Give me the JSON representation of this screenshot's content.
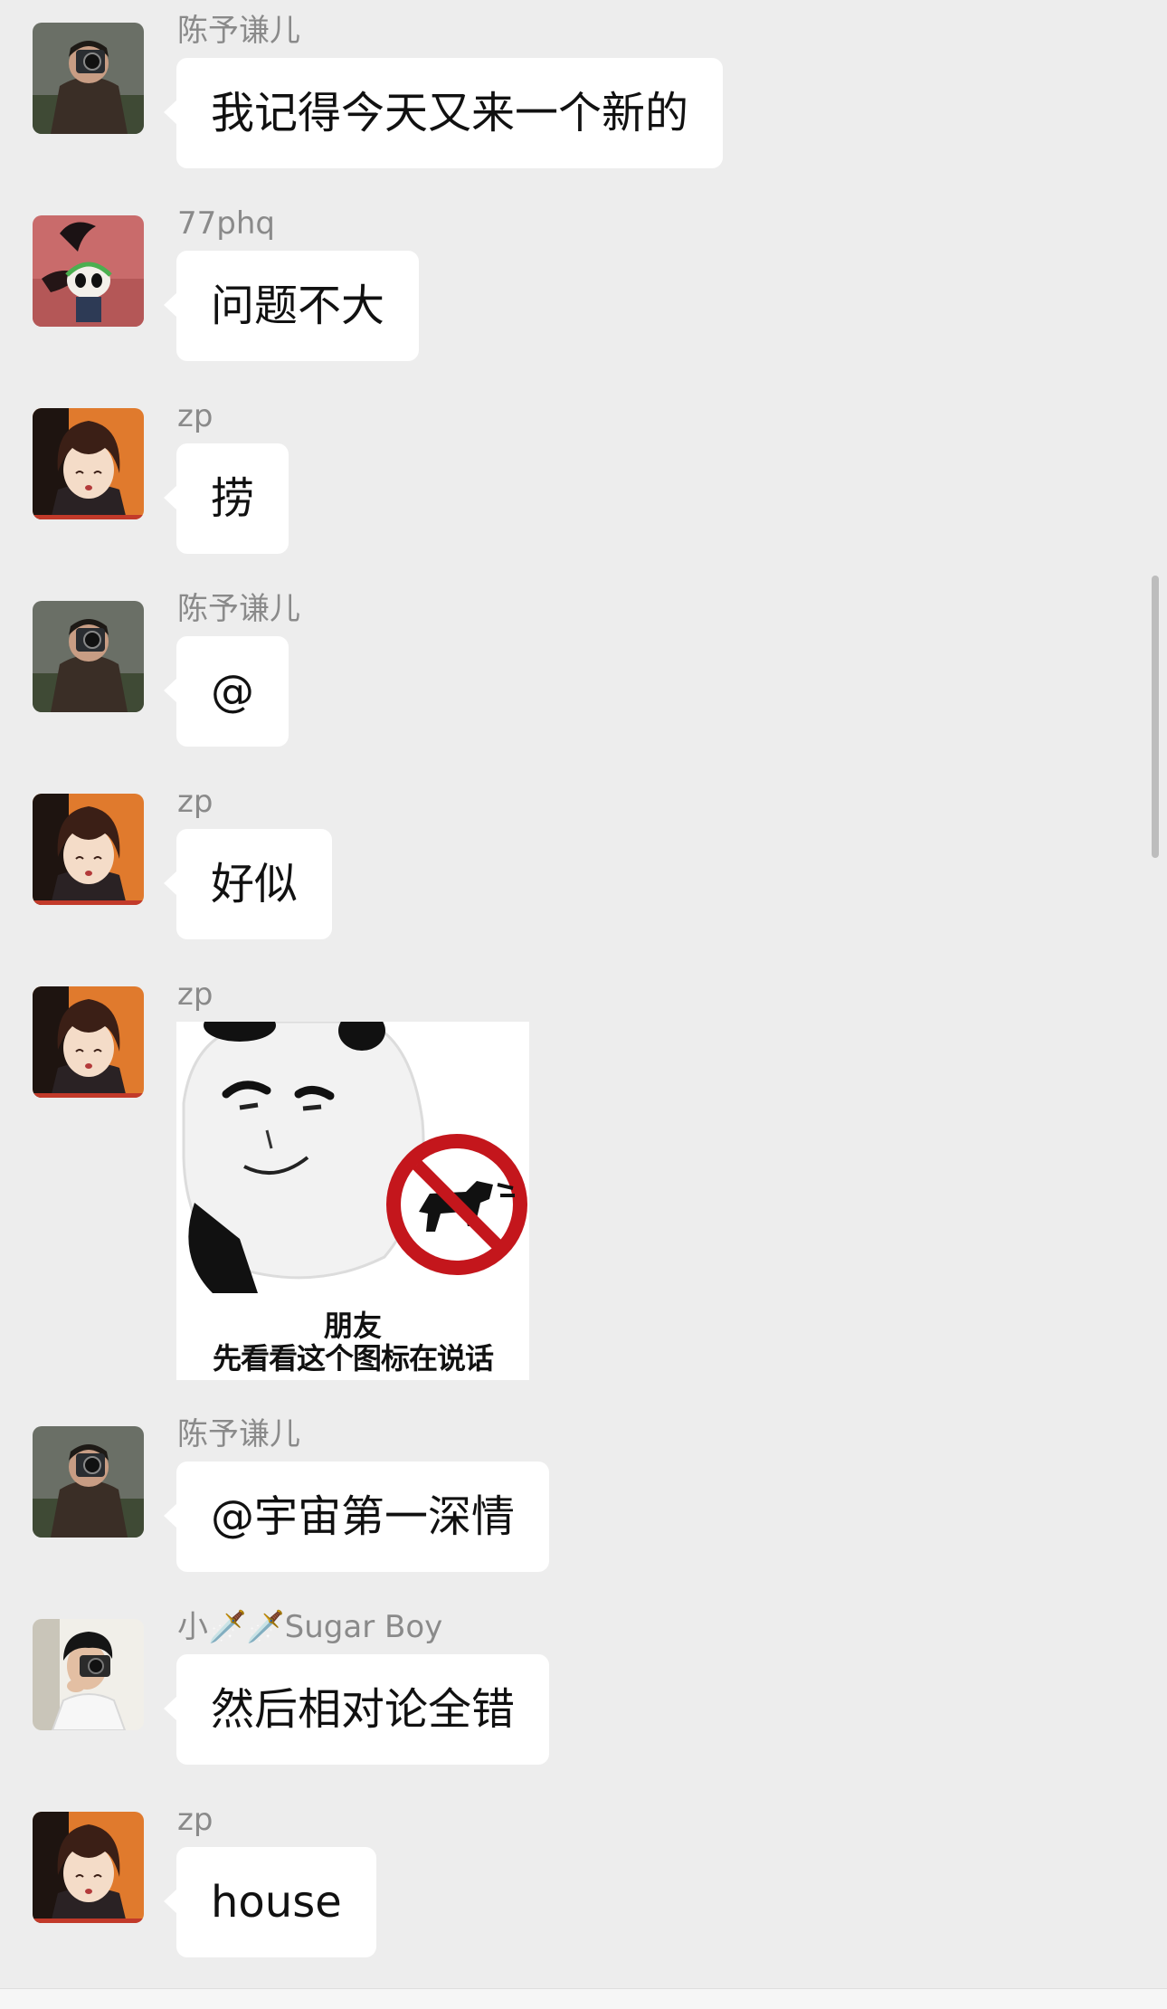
{
  "messages": [
    {
      "sender": "陈予谦儿",
      "text": "我记得今天又来一个新的",
      "avatar": "photo-with-camera"
    },
    {
      "sender": "77phq",
      "text": "问题不大",
      "avatar": "hollow-knight-art"
    },
    {
      "sender": "zp",
      "text": "捞",
      "avatar": "anime-boy-dazai"
    },
    {
      "sender": "陈予谦儿",
      "text": "@",
      "avatar": "photo-with-camera"
    },
    {
      "sender": "zp",
      "text": "好似",
      "avatar": "anime-boy-dazai"
    },
    {
      "sender": "zp",
      "sticker": {
        "line1": "朋友",
        "line2": "先看看这个图标在说话"
      },
      "avatar": "anime-boy-dazai"
    },
    {
      "sender": "陈予谦儿",
      "text": "@宇宙第一深情",
      "avatar": "photo-with-camera"
    },
    {
      "sender": "小🗡️🗡️Sugar Boy",
      "text": "然后相对论全错",
      "avatar": "boy-with-camera-photo"
    },
    {
      "sender": "zp",
      "text": "house",
      "avatar": "anime-boy-dazai"
    }
  ],
  "colors": {
    "background": "#ededed",
    "bubble": "#ffffff",
    "sender_text": "#8a8a8a",
    "message_text": "#111111",
    "no_dog_sign": "#c4161c"
  }
}
